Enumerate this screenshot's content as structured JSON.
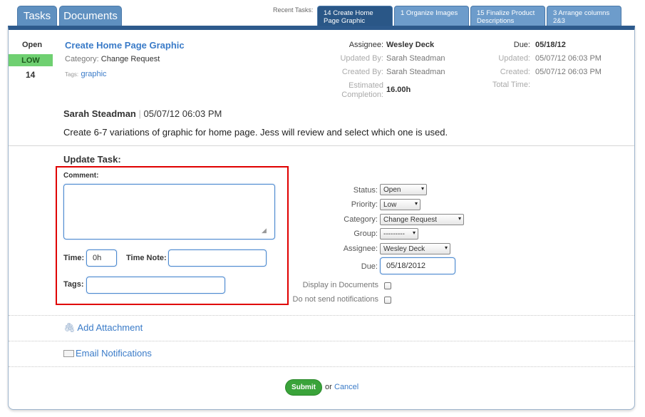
{
  "top_tabs": [
    "Tasks",
    "Documents"
  ],
  "recent": {
    "label": "Recent Tasks:",
    "tabs": [
      {
        "line1": "14 Create Home",
        "line2": "Page Graphic"
      },
      {
        "line1": "1 Organize Images",
        "line2": ""
      },
      {
        "line1": "15 Finalize Product",
        "line2": "Descriptions"
      },
      {
        "line1": "3 Arrange columns",
        "line2": "2&3"
      }
    ]
  },
  "task": {
    "status": "Open",
    "priority_badge": "LOW",
    "id": "14",
    "title": "Create Home Page Graphic",
    "category_label": "Category:",
    "category": "Change Request",
    "tags_label": "Tags:",
    "tag": "graphic",
    "assignee_label": "Assignee:",
    "assignee": "Wesley Deck",
    "updated_by_label": "Updated By:",
    "updated_by": "Sarah Steadman",
    "created_by_label": "Created By:",
    "created_by": "Sarah Steadman",
    "estimated_label_1": "Estimated",
    "estimated_label_2": "Completion:",
    "estimated": "16.00h",
    "due_label": "Due:",
    "due": "05/18/12",
    "updated_label": "Updated:",
    "updated": "05/07/12 06:03 PM",
    "created_label": "Created:",
    "created": "05/07/12 06:03 PM",
    "total_time_label": "Total Time:"
  },
  "comment": {
    "author": "Sarah Steadman",
    "separator": "|",
    "date": "05/07/12 06:03 PM",
    "body": "Create 6-7 variations of graphic for home page. Jess will review and select which one is used."
  },
  "update": {
    "heading": "Update Task:",
    "comment_label": "Comment:",
    "time_label": "Time:",
    "time_value": "0h",
    "time_note_label": "Time Note:",
    "tags_label": "Tags:",
    "status_label": "Status:",
    "status_value": "Open",
    "priority_label": "Priority:",
    "priority_value": "Low",
    "category_label": "Category:",
    "category_value": "Change Request",
    "group_label": "Group:",
    "group_value": "---------",
    "assignee_label": "Assignee:",
    "assignee_value": "Wesley Deck",
    "due_label": "Due:",
    "due_value": "05/18/2012",
    "display_docs_label": "Display in Documents",
    "no_notify_label": "Do not send notifications"
  },
  "links": {
    "add_attachment": "Add Attachment",
    "email_notifications": "Email Notifications"
  },
  "actions": {
    "submit": "Submit",
    "or": "or",
    "cancel": "Cancel"
  },
  "colors": {
    "nav_blue": "#5f90c0",
    "active_tab": "#2a5787",
    "link": "#3a7bc8",
    "low_badge": "#6fd071",
    "highlight_box": "#e00000",
    "submit": "#3aa33a"
  }
}
